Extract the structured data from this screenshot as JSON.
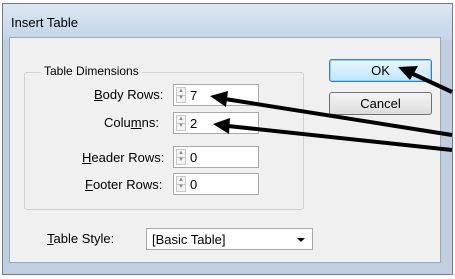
{
  "dialog": {
    "title": "Insert Table"
  },
  "dimensions": {
    "legend": "Table Dimensions",
    "body_rows": {
      "access_key": "B",
      "rest": "ody Rows:",
      "value": "7"
    },
    "columns": {
      "prefix": "Colu",
      "access_key": "m",
      "rest": "ns:",
      "value": "2"
    },
    "header_rows": {
      "access_key": "H",
      "rest": "eader Rows:",
      "value": "0"
    },
    "footer_rows": {
      "access_key": "F",
      "rest": "ooter Rows:",
      "value": "0"
    }
  },
  "table_style": {
    "access_key": "T",
    "rest": "able Style:",
    "value": "[Basic Table]"
  },
  "buttons": {
    "ok": "OK",
    "cancel": "Cancel"
  },
  "icons": {
    "spin_up": "spin-up-arrow-icon",
    "spin_down": "spin-down-arrow-icon",
    "dropdown": "chevron-down-icon",
    "annotation": "annotation-arrow"
  },
  "colors": {
    "dialog_frame": "#bfcfdf",
    "client_bg": "#f0f0f0",
    "default_button": "#bee6fd",
    "annotation_arrow": "#000000"
  }
}
